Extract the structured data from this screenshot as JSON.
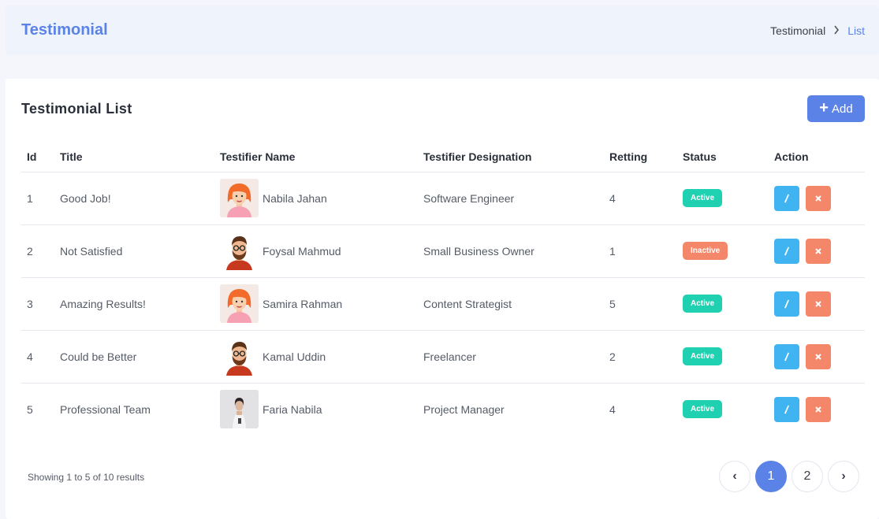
{
  "header": {
    "title": "Testimonial",
    "breadcrumb": [
      "Testimonial",
      "List"
    ]
  },
  "card": {
    "title": "Testimonial List",
    "add_label": "Add"
  },
  "table": {
    "columns": [
      "Id",
      "Title",
      "Testifier Name",
      "Testifier Designation",
      "Retting",
      "Status",
      "Action"
    ],
    "rows": [
      {
        "id": "1",
        "title": "Good Job!",
        "name": "Nabila Jahan",
        "avatar": "female-avatar",
        "designation": "Software Engineer",
        "rating": "4",
        "status": "Active"
      },
      {
        "id": "2",
        "title": "Not Satisfied",
        "name": "Foysal Mahmud",
        "avatar": "male-avatar",
        "designation": "Small Business Owner",
        "rating": "1",
        "status": "Inactive"
      },
      {
        "id": "3",
        "title": "Amazing Results!",
        "name": "Samira Rahman",
        "avatar": "female-avatar",
        "designation": "Content Strategist",
        "rating": "5",
        "status": "Active"
      },
      {
        "id": "4",
        "title": "Could be Better",
        "name": "Kamal Uddin",
        "avatar": "male-avatar",
        "designation": "Freelancer",
        "rating": "2",
        "status": "Active"
      },
      {
        "id": "5",
        "title": "Professional Team",
        "name": "Faria Nabila",
        "avatar": "photo-avatar",
        "designation": "Project Manager",
        "rating": "4",
        "status": "Active"
      }
    ]
  },
  "footer": {
    "showing_text": "Showing 1 to 5 of 10 results",
    "pages": [
      "1",
      "2"
    ],
    "current_page": "1",
    "prev_icon": "‹",
    "next_icon": "›"
  },
  "colors": {
    "accent": "#5b82e6",
    "active": "#1fd1b0",
    "inactive": "#f4876a",
    "edit": "#40b3f1"
  }
}
